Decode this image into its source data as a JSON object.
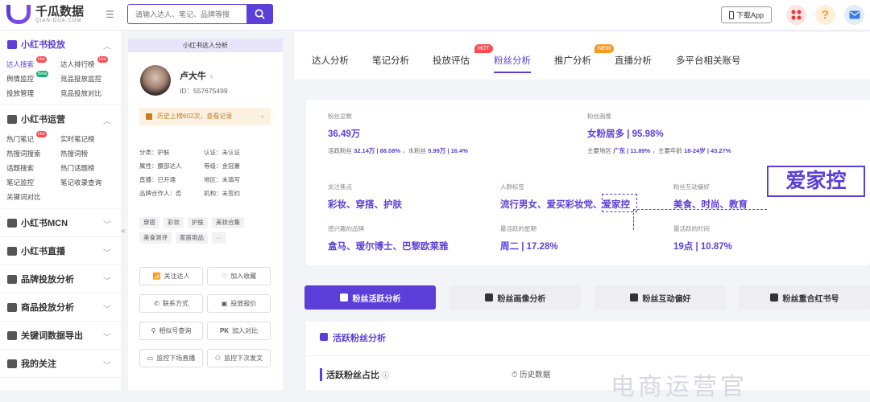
{
  "brand": {
    "title": "千瓜数据",
    "sub": "QIAN-GUA.COM"
  },
  "search": {
    "placeholder": "请输入达人、笔记、品牌等搜"
  },
  "header": {
    "download": "下载App",
    "help": "?"
  },
  "sidebar": {
    "sections": [
      {
        "title": "小红书投放",
        "items": [
          {
            "label": "达人搜索",
            "badge": "Hot"
          },
          {
            "label": "达人排行榜",
            "badge": "Hot"
          },
          {
            "label": "舆情监控",
            "badge": "Beta"
          },
          {
            "label": "竞品投放监控",
            "badge": ""
          },
          {
            "label": "投放管理",
            "badge": ""
          },
          {
            "label": "竞品投放对比",
            "badge": ""
          }
        ]
      },
      {
        "title": "小红书运营",
        "items": [
          {
            "label": "热门笔记",
            "badge": "Hot"
          },
          {
            "label": "实时笔记榜",
            "badge": ""
          },
          {
            "label": "热搜词搜索",
            "badge": ""
          },
          {
            "label": "热搜词榜",
            "badge": ""
          },
          {
            "label": "话题搜索",
            "badge": ""
          },
          {
            "label": "热门话题榜",
            "badge": ""
          },
          {
            "label": "笔记监控",
            "badge": ""
          },
          {
            "label": "笔记收录查询",
            "badge": ""
          },
          {
            "label": "关键词对比",
            "badge": ""
          }
        ]
      },
      {
        "title": "小红书MCN"
      },
      {
        "title": "小红书直播"
      },
      {
        "title": "品牌投放分析"
      },
      {
        "title": "商品投放分析"
      },
      {
        "title": "关键词数据导出"
      },
      {
        "title": "我的关注"
      }
    ]
  },
  "profile": {
    "header": "小红书达人分析",
    "name": "卢大牛",
    "id": "ID：557675499",
    "history": "历史上榜602次，查看记录",
    "info": [
      "分类：护肤",
      "认证：未认证",
      "属性：腰部达人",
      "等级：金冠薯",
      "直播：已开通",
      "地区：未填写",
      "品牌合作人：否",
      "机构：未签约"
    ],
    "tags": [
      "穿搭",
      "彩妆",
      "护肤",
      "美妆合集",
      "美食测评",
      "家居用品",
      "···"
    ],
    "actions": [
      "关注达人",
      "加入收藏",
      "联系方式",
      "投放报价",
      "相似号查询",
      "加入对比",
      "监控下场直播",
      "监控下次发文"
    ]
  },
  "tabs": [
    {
      "label": "达人分析",
      "badge": ""
    },
    {
      "label": "笔记分析",
      "badge": ""
    },
    {
      "label": "投放评估",
      "badge": "HOT"
    },
    {
      "label": "粉丝分析",
      "badge": ""
    },
    {
      "label": "推广分析",
      "badge": "NEW"
    },
    {
      "label": "直播分析",
      "badge": ""
    },
    {
      "label": "多平台相关账号",
      "badge": ""
    }
  ],
  "fans": {
    "total_label": "粉丝总数",
    "total": "36.49万",
    "active_text": "活跃粉丝 ",
    "active_val": "32.14万 | 88.08%",
    "water_text": " ，水粉丝 ",
    "water_val": "5.99万 | 16.4%",
    "portrait_label": "粉丝画像",
    "portrait": "女粉居多 | 95.98%",
    "region_text": "主要地区 ",
    "region_val": "广东 | 11.89%",
    "age_text": " ，主要年龄 ",
    "age_val": "18-24岁 | 43.27%",
    "focus_label": "关注焦点",
    "focus": "彩妆、穿搭、护肤",
    "crowd_label": "人群标签",
    "crowd": "流行男女、爱买彩妆党、爱家控",
    "interact_label": "粉丝互动偏好",
    "interact": "美食、时尚、教育",
    "brand_label": "感兴趣的品牌",
    "brand": "盒马、瑷尔博士、巴黎欧莱雅",
    "week_label": "最活跃的星期",
    "week": "周二 | 17.28%",
    "time_label": "最活跃的时间",
    "time": "19点 | 10.87%",
    "stamp": "爱家控"
  },
  "subtabs": [
    "粉丝活跃分析",
    "粉丝画像分析",
    "粉丝互动偏好",
    "粉丝重合红书号"
  ],
  "panel": {
    "title": "活跃粉丝分析",
    "subtitle": "活跃粉丝占比",
    "history": "历史数据",
    "watermark": "电商运营官"
  },
  "colors": {
    "accent": "#5b3fd8",
    "hot": "#ff4d4f",
    "beta": "#16b27a",
    "orange": "#f59a23"
  }
}
